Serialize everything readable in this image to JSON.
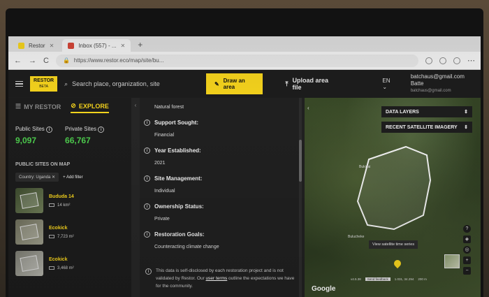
{
  "browser": {
    "tabs": [
      {
        "label": "Restor",
        "active": false
      },
      {
        "label": "Inbox (557) - ...",
        "active": true
      }
    ],
    "new_tab": "+",
    "url": "https://www.restor.eco/map/site/bu...",
    "nav": {
      "back": "←",
      "forward": "→",
      "reload": "C"
    }
  },
  "header": {
    "logo": "RESTOR",
    "logo_sub": "BETA",
    "search_placeholder": "Search place, organization, site",
    "draw_button": "Draw an area",
    "upload_button": "Upload area file",
    "language": "EN",
    "user_email": "batchaus@gmail.com",
    "user_name": "Batte",
    "user_sub": "batchaus@gmail.com"
  },
  "left": {
    "tab_my": "MY RESTOR",
    "tab_explore": "EXPLORE",
    "public_label": "Public Sites",
    "public_value": "9,097",
    "private_label": "Private Sites",
    "private_value": "66,767",
    "section_title": "PUBLIC SITES ON MAP",
    "filter_chip": "Country: Uganda",
    "add_filter": "Add filter",
    "sites": [
      {
        "name": "Bududa 14",
        "area": "14 km²"
      },
      {
        "name": "Ecokick",
        "area": "7,723 m²"
      },
      {
        "name": "Ecokick",
        "area": "3,468 m²"
      }
    ]
  },
  "middle": {
    "top_value": "Natural forest",
    "fields": [
      {
        "label": "Support Sought:",
        "value": "Financial"
      },
      {
        "label": "Year Established:",
        "value": "2021"
      },
      {
        "label": "Site Management:",
        "value": "Individual"
      },
      {
        "label": "Ownership Status:",
        "value": "Private"
      },
      {
        "label": "Restoration Goals:",
        "value": "Counteracting climate change"
      }
    ],
    "disclaimer_pre": "This data is self-disclosed by each restoration project and is not validated by Restor. Our ",
    "disclaimer_link": "user terms",
    "disclaimer_post": " outline the expectations we have for the community.",
    "collapse_icon": "‹"
  },
  "map": {
    "data_layers": "DATA LAYERS",
    "imagery": "RECENT SATELLITE IMAGERY",
    "place_label_1": "Bukigai",
    "place_label_2": "Bulucheke",
    "tooltip": "View satellite time series",
    "google": "Google",
    "attribution_version": "v4.5.38",
    "attribution_feedback": "Send feedback",
    "attribution_coords": "1.031, 34.294",
    "attribution_scale": "200 m",
    "collapse_icon": "‹"
  },
  "colors": {
    "accent": "#f5d31d",
    "stat_green": "#4cc94c",
    "panel": "#1c1c1c"
  }
}
